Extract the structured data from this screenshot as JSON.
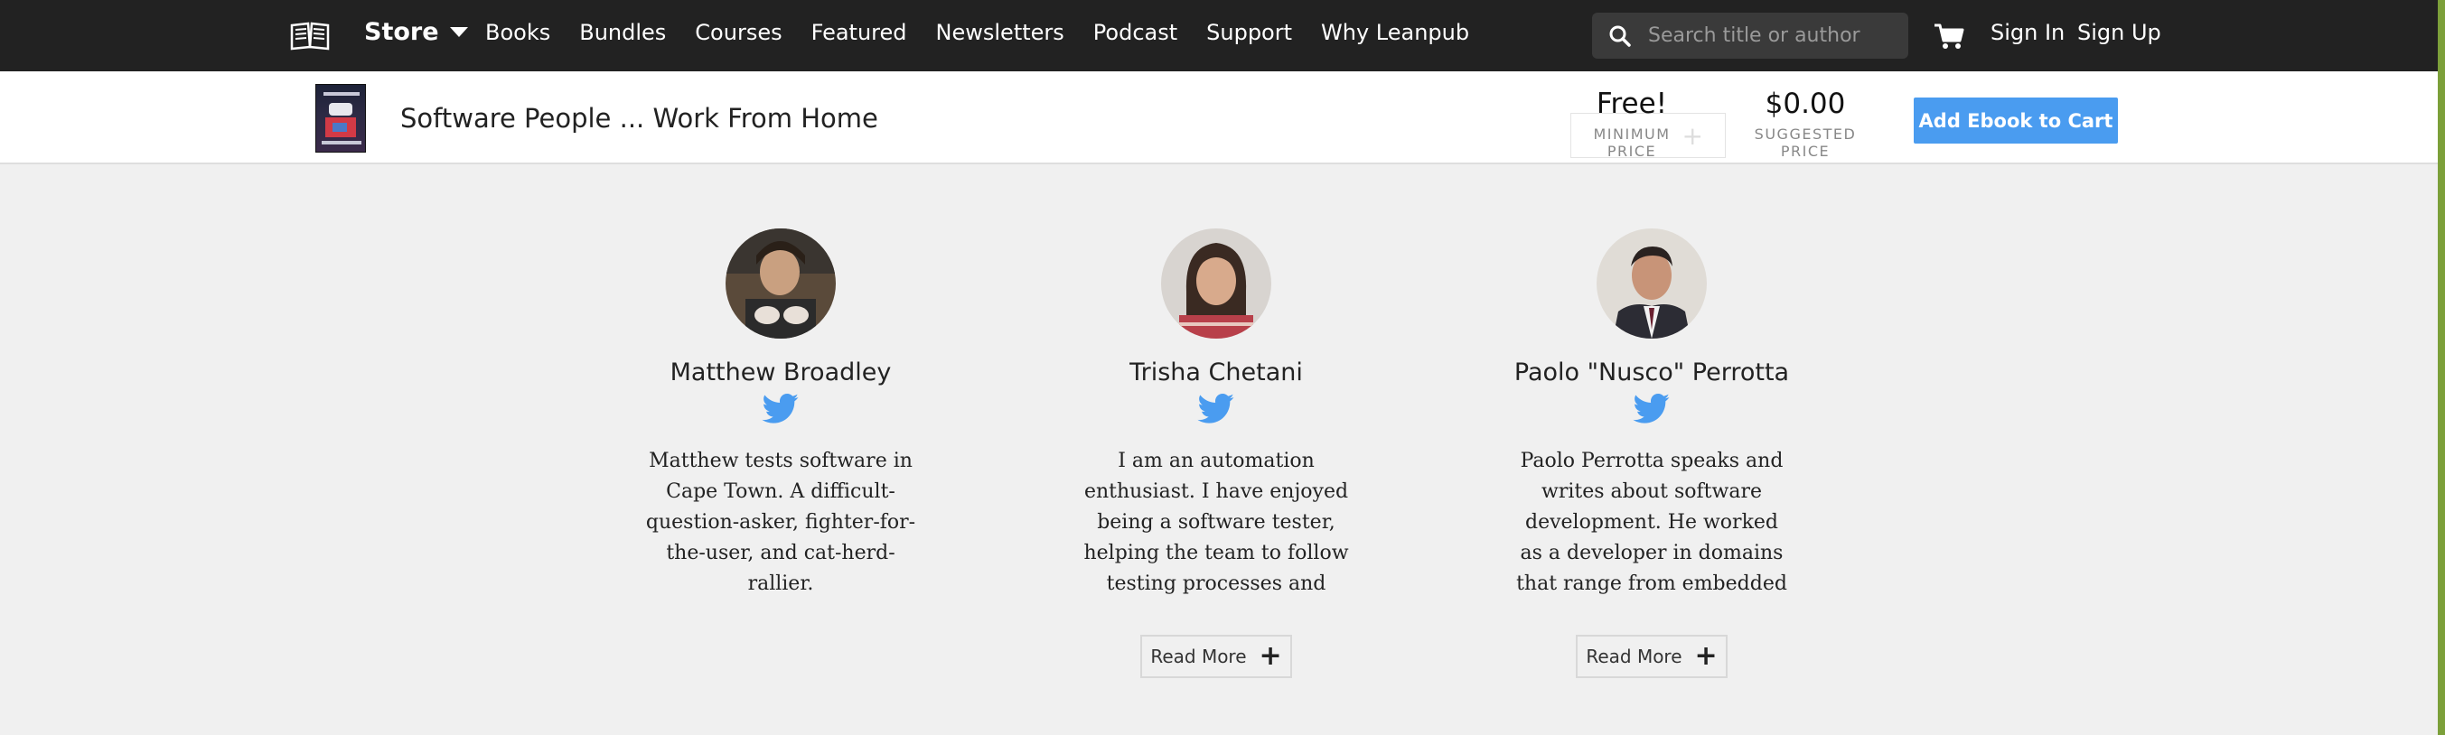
{
  "nav": {
    "store_label": "Store",
    "links": [
      "Books",
      "Bundles",
      "Courses",
      "Featured",
      "Newsletters",
      "Podcast",
      "Support",
      "Why Leanpub"
    ],
    "search_placeholder": "Search title or author",
    "sign_in": "Sign In",
    "sign_up": "Sign Up"
  },
  "book": {
    "title": "Software People ... Work From Home",
    "minimum_price": "Free!",
    "minimum_price_label": "MINIMUM PRICE",
    "suggested_price": "$0.00",
    "suggested_price_label": "SUGGESTED PRICE",
    "add_to_cart": "Add Ebook to Cart"
  },
  "authors": [
    {
      "name": "Matthew Broadley",
      "bio": "Matthew tests software in Cape Town. A difficult-question-asker, fighter-for-the-user, and cat-herd-rallier.",
      "read_more": null
    },
    {
      "name": "Trisha Chetani",
      "bio": "I am an automation enthusiast. I have enjoyed being a software tester, helping the team to follow testing processes and",
      "read_more": "Read More"
    },
    {
      "name": "Paolo \"Nusco\" Perrotta",
      "bio": "Paolo Perrotta speaks and writes about software development. He worked as a developer in domains that range from embedded to",
      "read_more": "Read More"
    }
  ],
  "colors": {
    "nav_bg": "#222222",
    "accent_blue": "#4a9cf0",
    "twitter_blue": "#4a9cf0",
    "page_bg": "#f0f0f0"
  },
  "icons": [
    "leanpub-book-icon",
    "chevron-down-icon",
    "search-icon",
    "cart-icon",
    "twitter-icon",
    "plus-icon"
  ]
}
